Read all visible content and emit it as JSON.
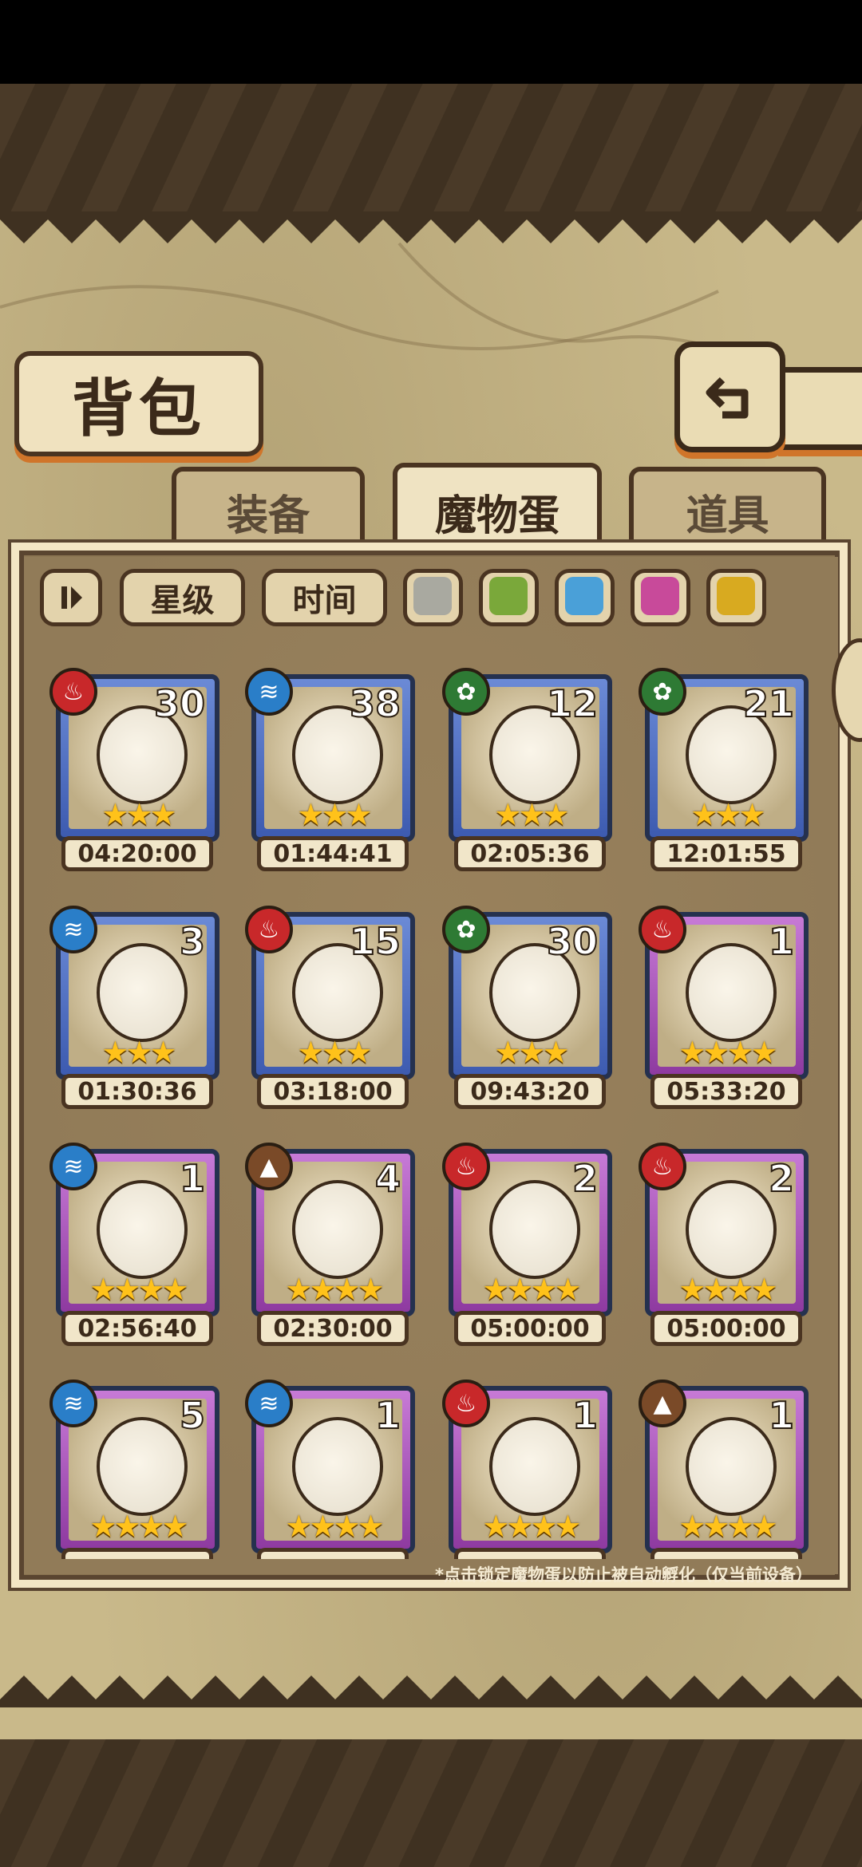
{
  "header": {
    "title": "背包"
  },
  "tabs": [
    {
      "label": "装备",
      "active": false
    },
    {
      "label": "魔物蛋",
      "active": true
    },
    {
      "label": "道具",
      "active": false
    }
  ],
  "filters": {
    "sort_icon": "pause-sort-icon",
    "star_label": "星级",
    "time_label": "时间",
    "color_swatches": [
      "#a9a9a0",
      "#7aa83a",
      "#4aa0d8",
      "#c84a9a",
      "#d8aa20"
    ]
  },
  "elements": {
    "fire": {
      "color": "#c8282a",
      "glyph": "♨"
    },
    "water": {
      "color": "#2a7ec8",
      "glyph": "≋"
    },
    "leaf": {
      "color": "#2e7a34",
      "glyph": "✿"
    },
    "earth": {
      "color": "#7a4a28",
      "glyph": "▲"
    }
  },
  "eggs": [
    {
      "count": "30",
      "stars": "★★★",
      "time": "04:20:00",
      "element": "fire",
      "frame": "blue",
      "icon": "sun-egg-icon"
    },
    {
      "count": "38",
      "stars": "★★★",
      "time": "01:44:41",
      "element": "water",
      "frame": "blue",
      "icon": "cloud-egg-icon"
    },
    {
      "count": "12",
      "stars": "★★★",
      "time": "02:05:36",
      "element": "leaf",
      "frame": "blue",
      "icon": "helmet-egg-icon"
    },
    {
      "count": "21",
      "stars": "★★★",
      "time": "12:01:55",
      "element": "leaf",
      "frame": "blue",
      "icon": "leaf-egg-icon"
    },
    {
      "count": "3",
      "stars": "★★★",
      "time": "01:30:36",
      "element": "water",
      "frame": "blue",
      "icon": "eye-egg-icon"
    },
    {
      "count": "15",
      "stars": "★★★",
      "time": "03:18:00",
      "element": "fire",
      "frame": "blue",
      "icon": "pink-egg-icon"
    },
    {
      "count": "30",
      "stars": "★★★",
      "time": "09:43:20",
      "element": "leaf",
      "frame": "blue",
      "icon": "ghost-egg-icon"
    },
    {
      "count": "1",
      "stars": "★★★★",
      "time": "05:33:20",
      "element": "fire",
      "frame": "purple",
      "icon": "dagger-egg-icon"
    },
    {
      "count": "1",
      "stars": "★★★★",
      "time": "02:56:40",
      "element": "water",
      "frame": "purple",
      "icon": "web-egg-icon"
    },
    {
      "count": "4",
      "stars": "★★★★",
      "time": "02:30:00",
      "element": "earth",
      "frame": "purple",
      "icon": "wood-egg-icon"
    },
    {
      "count": "2",
      "stars": "★★★★",
      "time": "05:00:00",
      "element": "fire",
      "frame": "purple",
      "icon": "hammer-egg-icon"
    },
    {
      "count": "2",
      "stars": "★★★★",
      "time": "05:00:00",
      "element": "fire",
      "frame": "purple",
      "icon": "dark-hammer-egg-icon"
    },
    {
      "count": "5",
      "stars": "★★★★",
      "time": "",
      "element": "water",
      "frame": "purple",
      "icon": "water-swirl-egg-icon"
    },
    {
      "count": "1",
      "stars": "★★★★",
      "time": "",
      "element": "water",
      "frame": "purple",
      "icon": "hooded-egg-icon"
    },
    {
      "count": "1",
      "stars": "★★★★",
      "time": "",
      "element": "fire",
      "frame": "purple",
      "icon": "demon-egg-icon"
    },
    {
      "count": "1",
      "stars": "★★★★",
      "time": "",
      "element": "earth",
      "frame": "purple",
      "icon": "gear-egg-icon"
    }
  ],
  "hint": "*点击锁定魔物蛋以防止被自动孵化（仅当前设备）"
}
